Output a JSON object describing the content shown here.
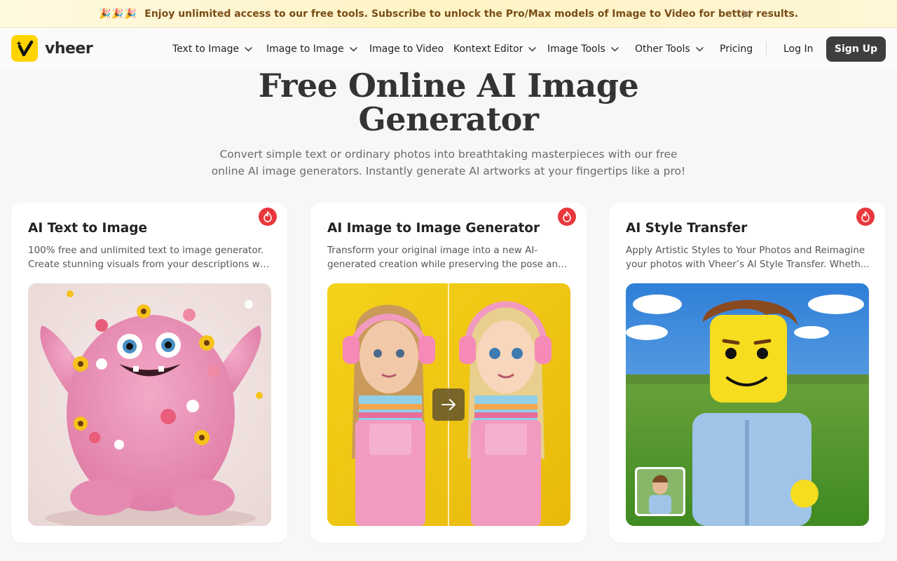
{
  "banner": {
    "emoji": "🎉🎉🎉",
    "text": "Enjoy unlimited access to our free tools. Subscribe to unlock the Pro/Max models of Image to Video for better results."
  },
  "brand": {
    "name": "vheer",
    "accent": "#ffd400"
  },
  "nav": {
    "items": [
      {
        "label": "Text to Image",
        "dropdown": true
      },
      {
        "label": "Image to Image",
        "dropdown": true
      },
      {
        "label": "Image to Video",
        "dropdown": false
      },
      {
        "label": "Kontext Editor",
        "dropdown": true
      },
      {
        "label": "Image Tools",
        "dropdown": true
      },
      {
        "label": "Other Tools",
        "dropdown": true
      },
      {
        "label": "Pricing",
        "dropdown": false
      }
    ],
    "login": "Log In",
    "signup": "Sign Up"
  },
  "hero": {
    "title_line1": "Free Online AI Image",
    "title_line2": "Generator",
    "subtitle_line1": "Convert simple text or ordinary photos into breathtaking masterpieces with our free",
    "subtitle_line2": "online AI image generators. Instantly generate AI artworks at your fingertips like a pro!"
  },
  "cards": [
    {
      "title": "AI Text to Image",
      "desc_line1": "100% free and unlimited text to image generator.",
      "desc_line2": "Create stunning visuals from your descriptions wit...",
      "badge_icon": "fire-icon"
    },
    {
      "title": "AI Image to Image Generator",
      "desc_line1": "Transform your original image into a new AI-",
      "desc_line2": "generated creation while preserving the pose and...",
      "badge_icon": "fire-icon"
    },
    {
      "title": "AI Style Transfer",
      "desc_line1": "Apply Artistic Styles to Your Photos and Reimagine",
      "desc_line2": "your photos with Vheer’s AI Style Transfer. Wheth...",
      "badge_icon": "fire-icon"
    }
  ],
  "colors": {
    "banner_text": "#7a4d16",
    "signup_bg": "#3e3e3e",
    "fire_badge": "#e8383d"
  }
}
